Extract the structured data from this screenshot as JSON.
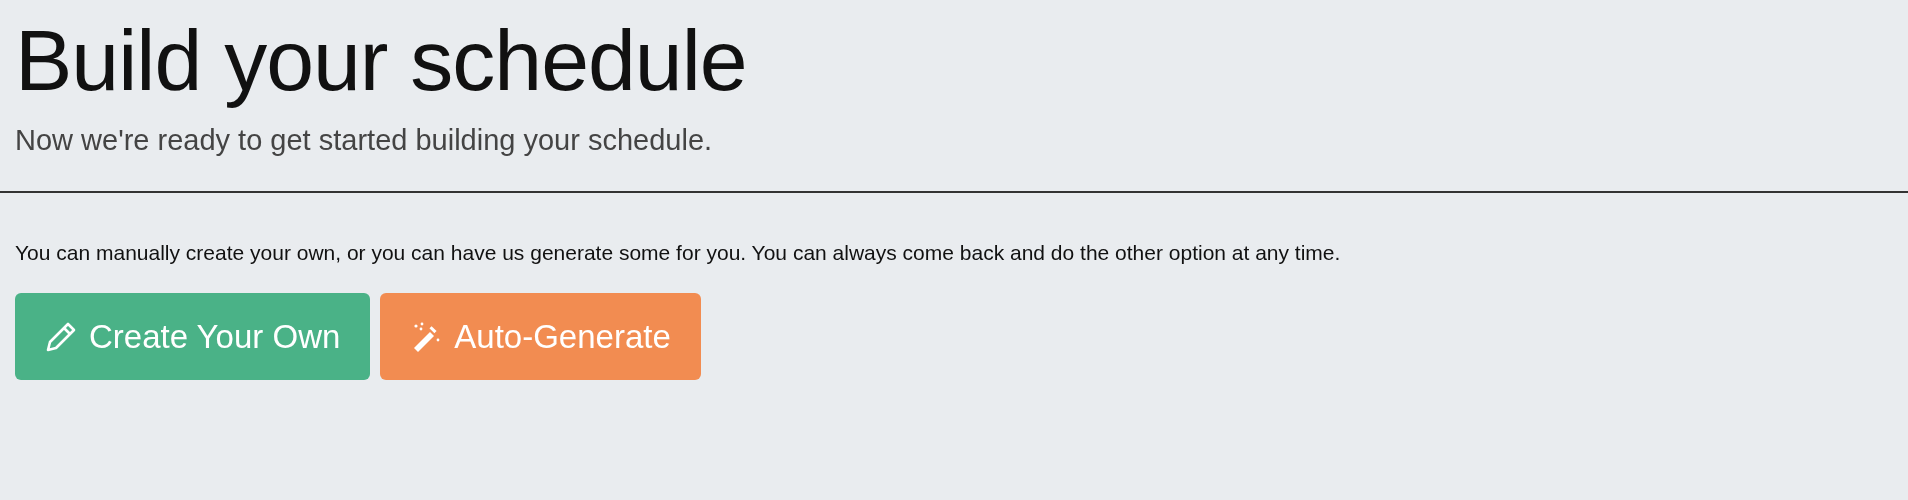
{
  "title": "Build your schedule",
  "subtitle": "Now we're ready to get started building your schedule.",
  "description": "You can manually create your own, or you can have us generate some for you. You can always come back and do the other option at any time.",
  "buttons": [
    {
      "label": "Create Your Own",
      "kind": "manual",
      "color": "#4ab287"
    },
    {
      "label": "Auto-Generate",
      "kind": "auto",
      "color": "#f28c51"
    }
  ]
}
